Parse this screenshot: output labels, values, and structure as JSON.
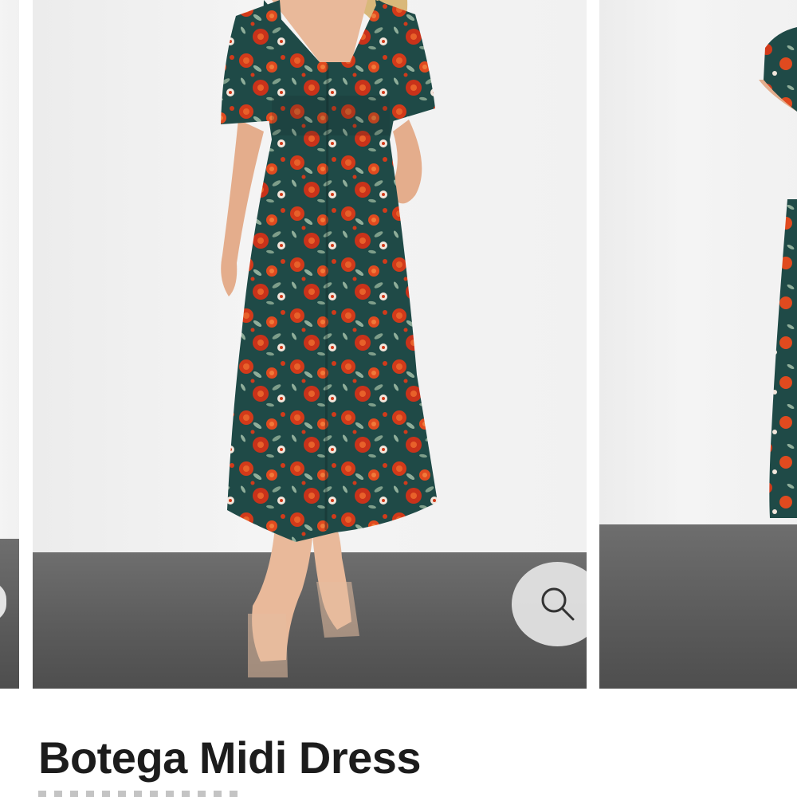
{
  "product": {
    "title": "Botega Midi Dress"
  },
  "gallery": {
    "zoom_icon": "magnifier-icon",
    "colors": {
      "dress_base": "#1f4a47",
      "flower_red": "#d23a1a",
      "flower_orange": "#e8612a",
      "leaf": "#8fae9a",
      "skin": "#e9b99a",
      "hair": "#d9b87a",
      "wall": "#f1f1f1",
      "floor": "#5e5e5e",
      "zoom_button_bg": "#e6e6e6"
    }
  }
}
